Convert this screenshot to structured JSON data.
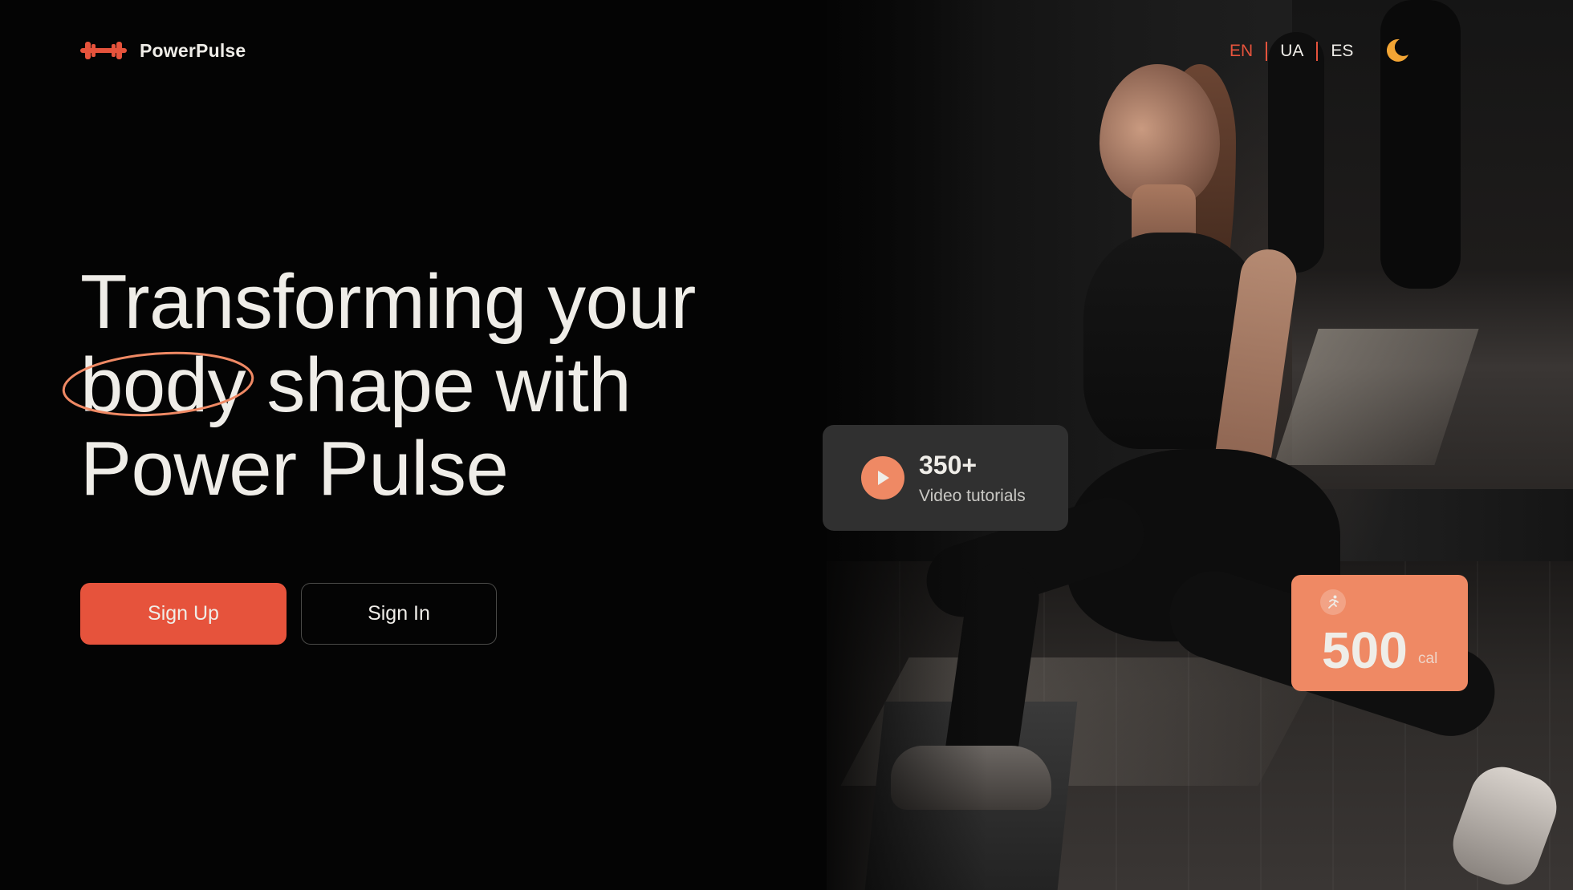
{
  "header": {
    "brand_name": "PowerPulse",
    "logo_icon": "dumbbell-icon",
    "languages": [
      {
        "code": "EN",
        "active": true
      },
      {
        "code": "UA",
        "active": false
      },
      {
        "code": "ES",
        "active": false
      }
    ],
    "theme_toggle_icon": "moon-icon"
  },
  "hero": {
    "title_line1": "Transforming your",
    "title_accent": "body",
    "title_line2_rest": " shape with",
    "title_line3": "Power Pulse",
    "sign_up_label": "Sign Up",
    "sign_in_label": "Sign In"
  },
  "stats": {
    "video": {
      "count": "350+",
      "label": "Video tutorials",
      "icon": "play-icon"
    },
    "calories": {
      "value": "500",
      "unit": "cal",
      "icon": "running-icon"
    }
  },
  "colors": {
    "background": "#040404",
    "accent": "#e6533c",
    "accent_light": "#ef8964",
    "text": "#efede8",
    "card_dark": "#303030",
    "moon": "#efa082"
  }
}
